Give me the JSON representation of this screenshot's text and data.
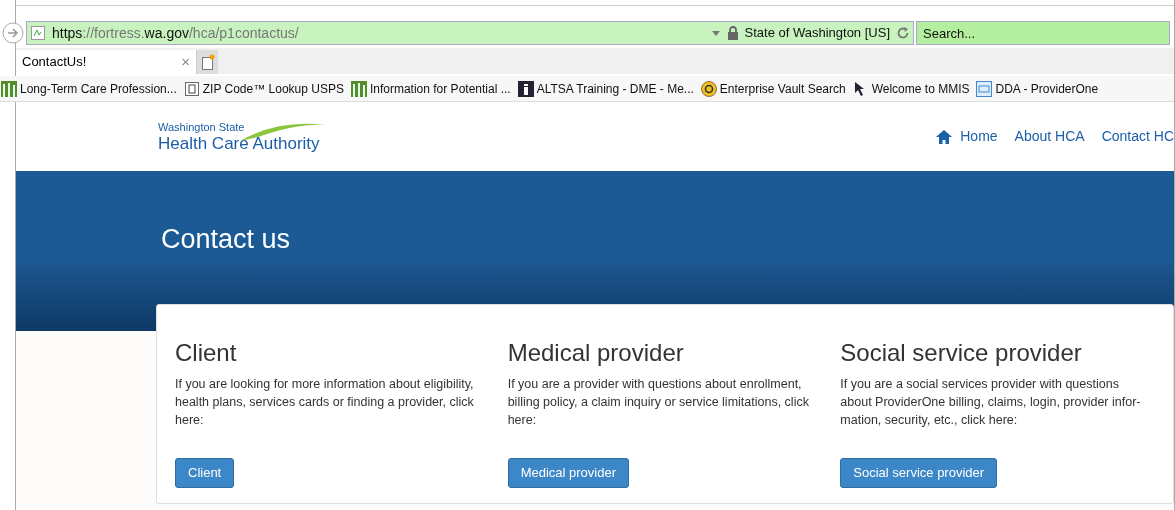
{
  "browser": {
    "url_parts": [
      {
        "text": "https",
        "emphasized": true
      },
      {
        "text": "://fortress.",
        "emphasized": false
      },
      {
        "text": "wa.gov",
        "emphasized": true
      },
      {
        "text": "/hca/p1contactus/",
        "emphasized": false
      }
    ],
    "site_identity": "State of Washington [US]",
    "search": {
      "placeholder": "Search..."
    },
    "tabs": [
      {
        "label": "ContactUs!",
        "selected": true,
        "close": "×"
      }
    ],
    "bookmarks": [
      {
        "label": "Long-Term Care Profession...",
        "kind": "bars"
      },
      {
        "label": "ZIP Code™ Lookup  USPS",
        "kind": "page"
      },
      {
        "label": "Information for Potential ...",
        "kind": "bars"
      },
      {
        "label": "ALTSA Training - DME - Me...",
        "kind": "info"
      },
      {
        "label": "Enterprise Vault Search",
        "kind": "vault"
      },
      {
        "label": "Welcome to MMIS",
        "kind": "cursor"
      },
      {
        "label": "DDA - ProviderOne",
        "kind": "grid"
      }
    ]
  },
  "site": {
    "logo": {
      "line_1": "Washington State",
      "line_2": "Health Care Authority"
    },
    "nav": [
      "Home",
      "About HCA",
      "Contact HC"
    ],
    "title": "Contact us",
    "sections": [
      {
        "heading": "Client",
        "text": "If you are looking for more information about eligibility, health plans, services cards or finding a provider, click here:",
        "button": "Client"
      },
      {
        "heading": "Medical provider",
        "text": "If you are a provider with questions about enrollment, billing policy, a claim inquiry or service limitations, click here:",
        "button": "Medical provider"
      },
      {
        "heading": "Social service provider",
        "text": "If you are a social services provider with questions about ProviderOne billing, claims, login, provider infor-mation, security, etc., click here:",
        "button": "Social service provider"
      }
    ]
  }
}
